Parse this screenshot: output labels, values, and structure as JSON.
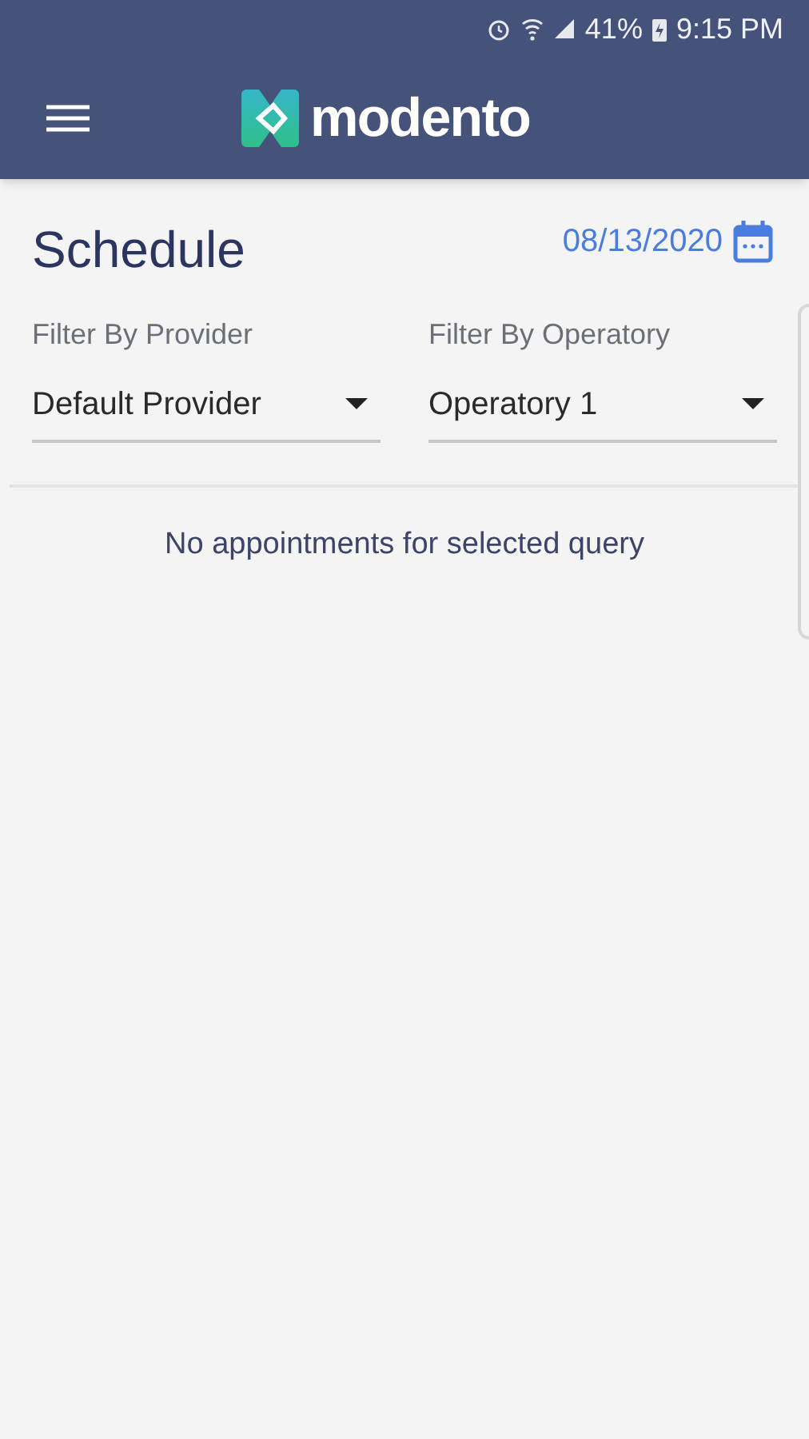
{
  "status_bar": {
    "battery": "41%",
    "time": "9:15 PM"
  },
  "app_bar": {
    "logo_text": "modento"
  },
  "header": {
    "title": "Schedule",
    "date": "08/13/2020"
  },
  "filters": [
    {
      "label": "Filter By Provider",
      "value": "Default Provider"
    },
    {
      "label": "Filter By Operatory",
      "value": "Operatory 1"
    }
  ],
  "empty_message": "No appointments for selected query"
}
